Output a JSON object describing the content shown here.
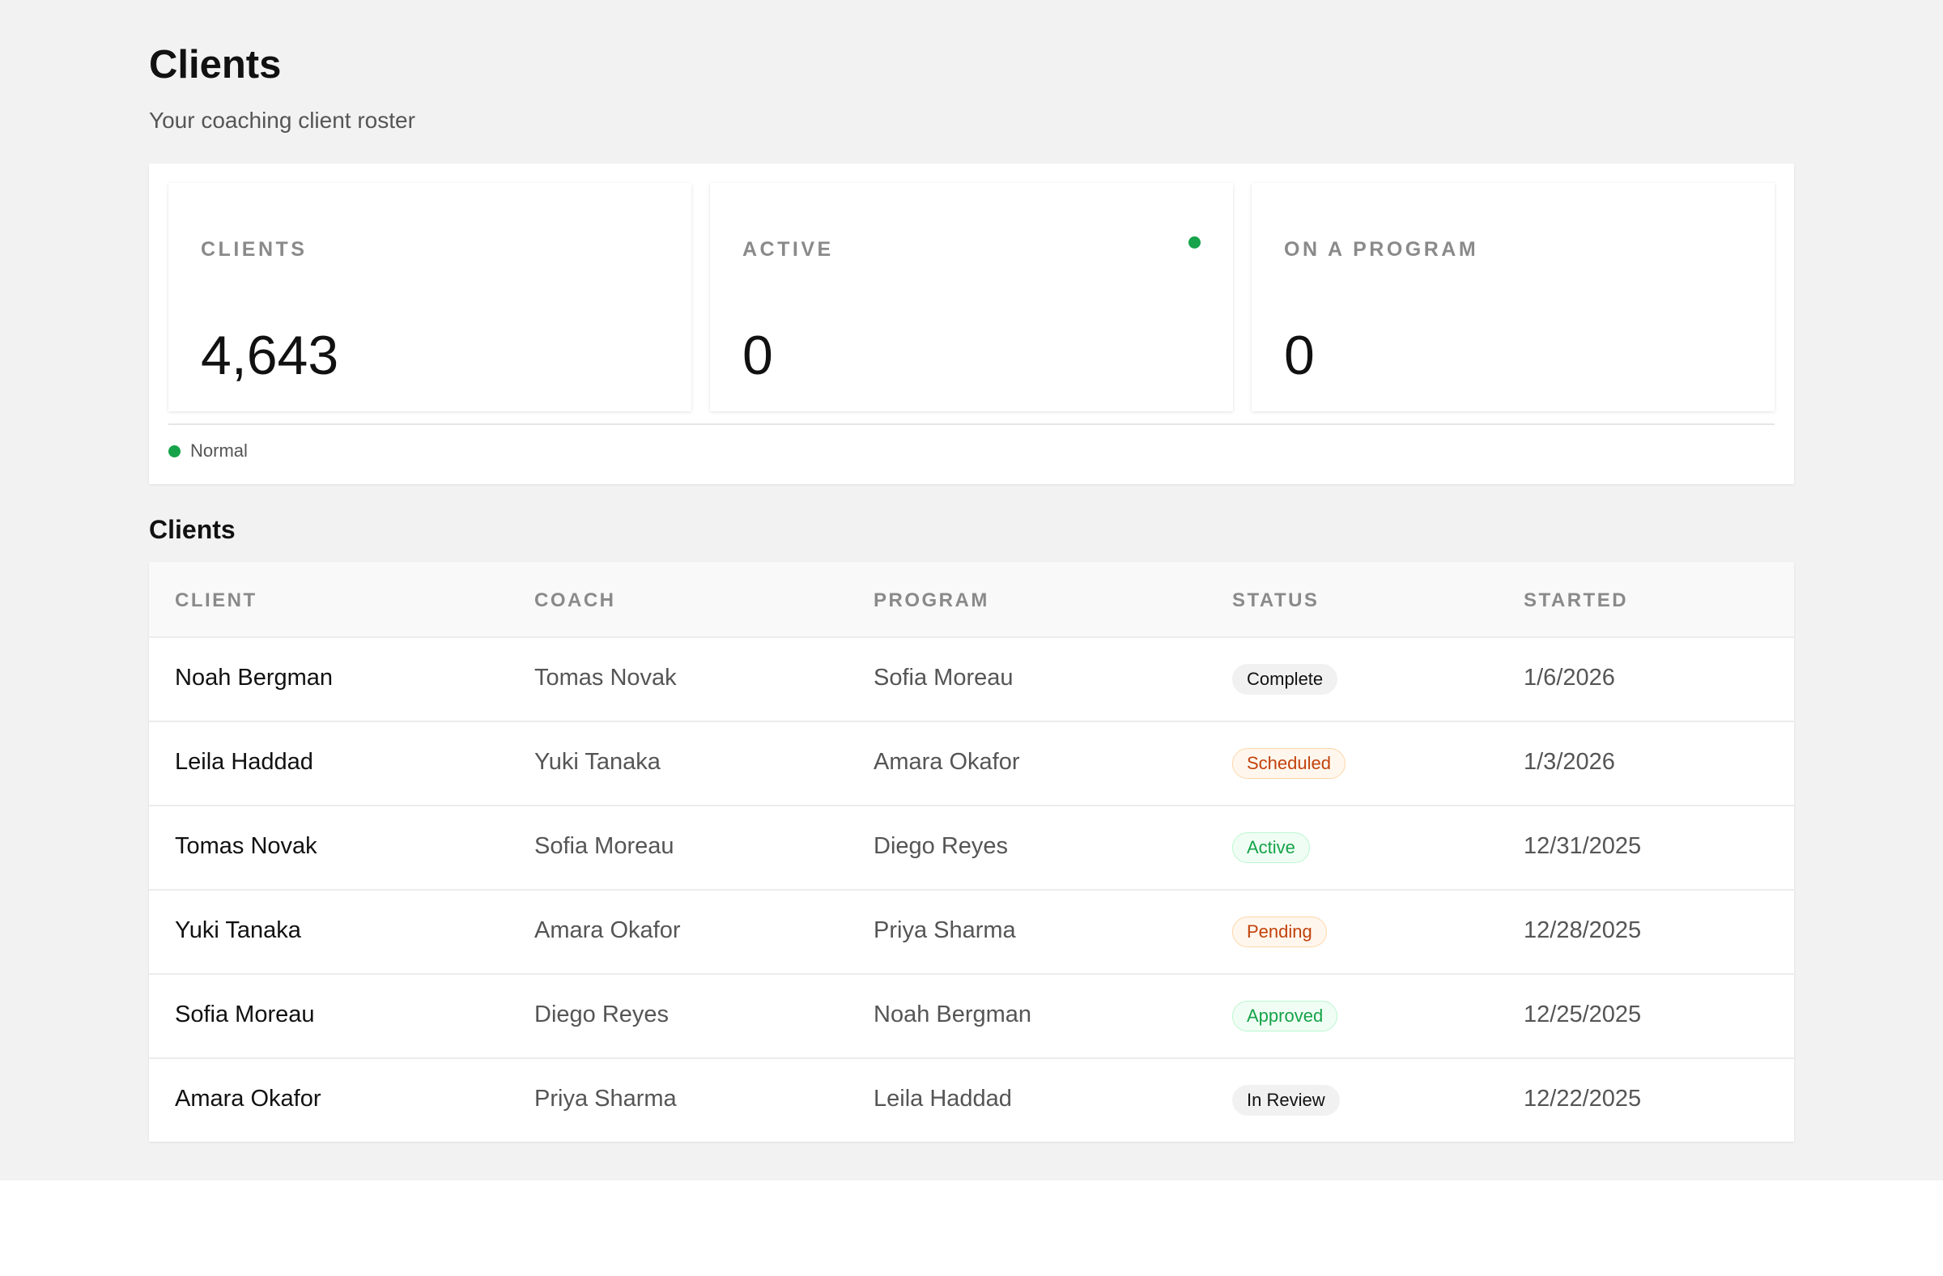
{
  "header": {
    "title": "Clients",
    "subtitle": "Your coaching client roster"
  },
  "stats": [
    {
      "label": "CLIENTS",
      "value": "4,643",
      "has_dot": false
    },
    {
      "label": "ACTIVE",
      "value": "0",
      "has_dot": true
    },
    {
      "label": "ON A PROGRAM",
      "value": "0",
      "has_dot": false
    }
  ],
  "panel_status": {
    "text": "Normal",
    "color": "#16a34a"
  },
  "table": {
    "section_title": "Clients",
    "columns": [
      "CLIENT",
      "COACH",
      "PROGRAM",
      "STATUS",
      "STARTED"
    ],
    "rows": [
      {
        "client": "Noah Bergman",
        "coach": "Tomas Novak",
        "program": "Sofia Moreau",
        "status": "Complete",
        "status_style": "neutral",
        "started": "1/6/2026"
      },
      {
        "client": "Leila Haddad",
        "coach": "Yuki Tanaka",
        "program": "Amara Okafor",
        "status": "Scheduled",
        "status_style": "warning",
        "started": "1/3/2026"
      },
      {
        "client": "Tomas Novak",
        "coach": "Sofia Moreau",
        "program": "Diego Reyes",
        "status": "Active",
        "status_style": "success",
        "started": "12/31/2025"
      },
      {
        "client": "Yuki Tanaka",
        "coach": "Amara Okafor",
        "program": "Priya Sharma",
        "status": "Pending",
        "status_style": "warning",
        "started": "12/28/2025"
      },
      {
        "client": "Sofia Moreau",
        "coach": "Diego Reyes",
        "program": "Noah Bergman",
        "status": "Approved",
        "status_style": "success",
        "started": "12/25/2025"
      },
      {
        "client": "Amara Okafor",
        "coach": "Priya Sharma",
        "program": "Leila Haddad",
        "status": "In Review",
        "status_style": "neutral",
        "started": "12/22/2025"
      }
    ]
  },
  "colors": {
    "accent_green": "#16a34a",
    "warning_orange": "#c2410c",
    "page_background": "#f2f2f2"
  }
}
